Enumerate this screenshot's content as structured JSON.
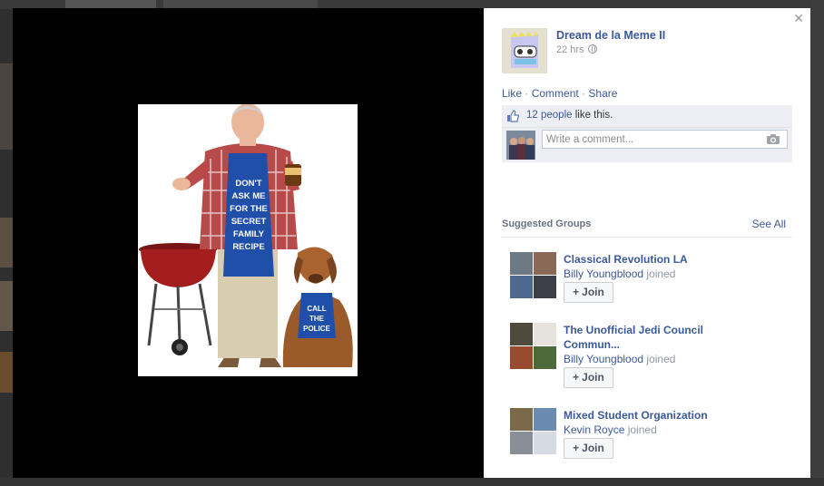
{
  "post": {
    "poster_name": "Dream de la Meme II",
    "time": "22 hrs",
    "actions": {
      "like": "Like",
      "comment": "Comment",
      "share": "Share",
      "sep": "·"
    },
    "likes": {
      "count": "12 people",
      "suffix": "like this."
    },
    "comment_placeholder": "Write a comment..."
  },
  "photo": {
    "apron_text": [
      "DON'T",
      "ASK ME",
      "FOR THE",
      "SECRET",
      "FAMILY",
      "RECIPE"
    ],
    "dog_apron_text": [
      "CALL",
      "THE",
      "POLICE"
    ]
  },
  "suggested": {
    "title": "Suggested Groups",
    "see_all": "See All",
    "groups": [
      {
        "name": "Classical Revolution LA",
        "member": "Billy Youngblood",
        "verb": "joined",
        "join": "Join"
      },
      {
        "name": "The Unofficial Jedi Council Commun...",
        "member": "Billy Youngblood",
        "verb": "joined",
        "join": "Join"
      },
      {
        "name": "Mixed Student Organization",
        "member": "Kevin Royce",
        "verb": "joined",
        "join": "Join"
      }
    ]
  },
  "icons": {
    "close": "close-icon",
    "globe": "globe-icon",
    "thumb": "thumbs-up-icon",
    "camera": "camera-icon",
    "plus": "plus-icon"
  },
  "colors": {
    "link": "#3b5998",
    "ufi_bg": "#edeff4",
    "stage": "#000000",
    "apron": "#1f4fa8"
  }
}
